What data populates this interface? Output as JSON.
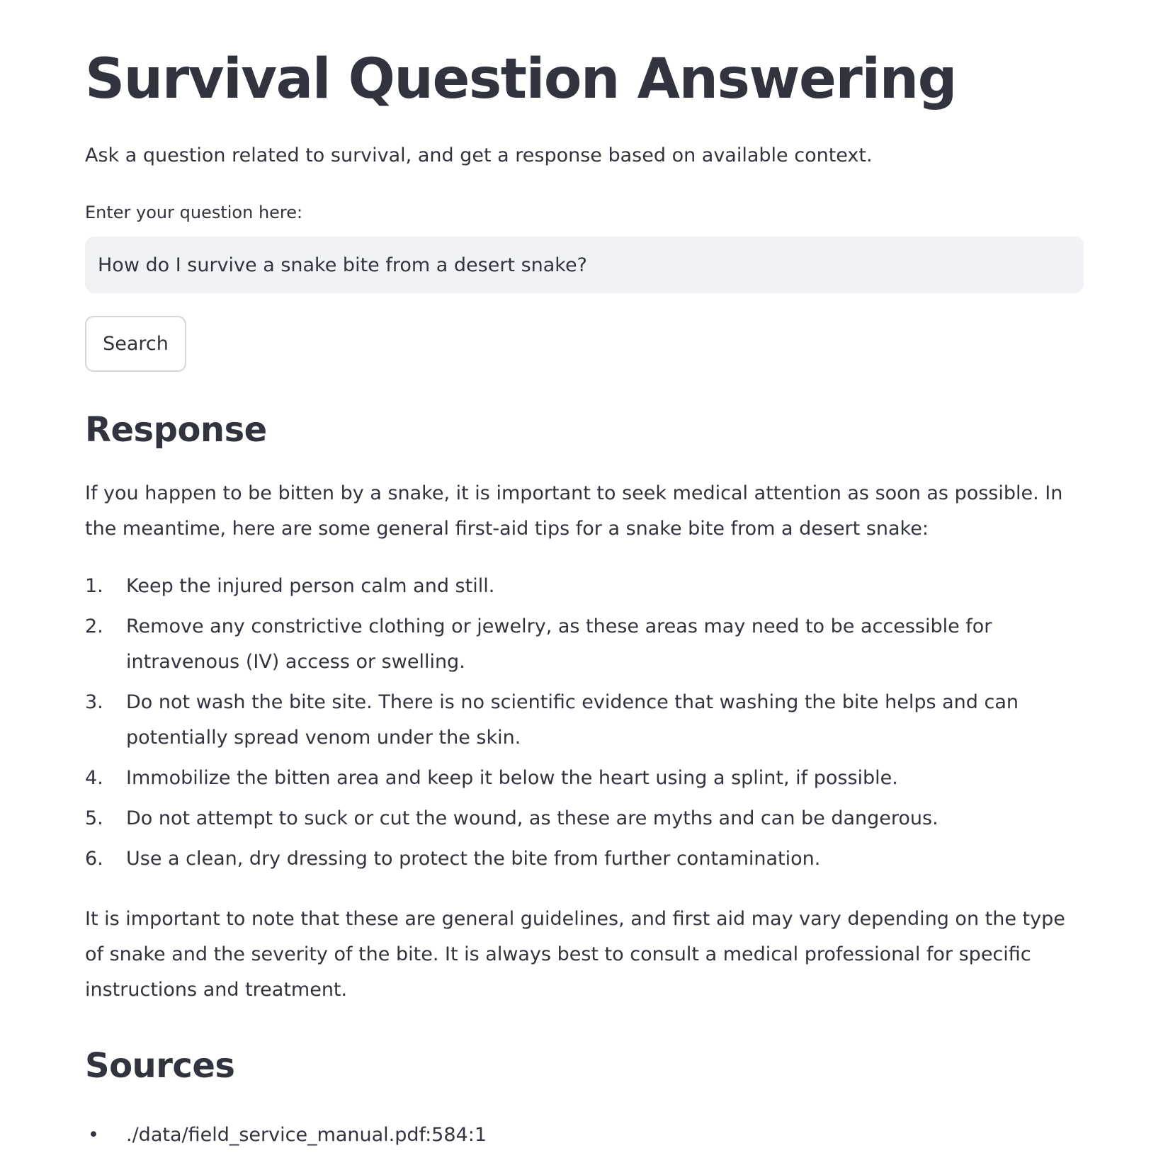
{
  "page": {
    "title": "Survival Question Answering",
    "subtitle": "Ask a question related to survival, and get a response based on available context."
  },
  "question": {
    "label": "Enter your question here:",
    "value": "How do I survive a snake bite from a desert snake?"
  },
  "search_button": {
    "label": "Search"
  },
  "response": {
    "heading": "Response",
    "intro": "If you happen to be bitten by a snake, it is important to seek medical attention as soon as possible. In the meantime, here are some general first-aid tips for a snake bite from a desert snake:",
    "steps": [
      {
        "num": "1.",
        "text": "Keep the injured person calm and still."
      },
      {
        "num": "2.",
        "text": "Remove any constrictive clothing or jewelry, as these areas may need to be accessible for intravenous (IV) access or swelling."
      },
      {
        "num": "3.",
        "text": "Do not wash the bite site. There is no scientific evidence that washing the bite helps and can potentially spread venom under the skin."
      },
      {
        "num": "4.",
        "text": "Immobilize the bitten area and keep it below the heart using a splint, if possible."
      },
      {
        "num": "5.",
        "text": "Do not attempt to suck or cut the wound, as these are myths and can be dangerous."
      },
      {
        "num": "6.",
        "text": "Use a clean, dry dressing to protect the bite from further contamination."
      }
    ],
    "outro": "It is important to note that these are general guidelines, and first aid may vary depending on the type of snake and the severity of the bite. It is always best to consult a medical professional for specific instructions and treatment."
  },
  "sources": {
    "heading": "Sources",
    "items": [
      {
        "bullet": "•",
        "text": "./data/field_service_manual.pdf:584:1"
      }
    ]
  }
}
